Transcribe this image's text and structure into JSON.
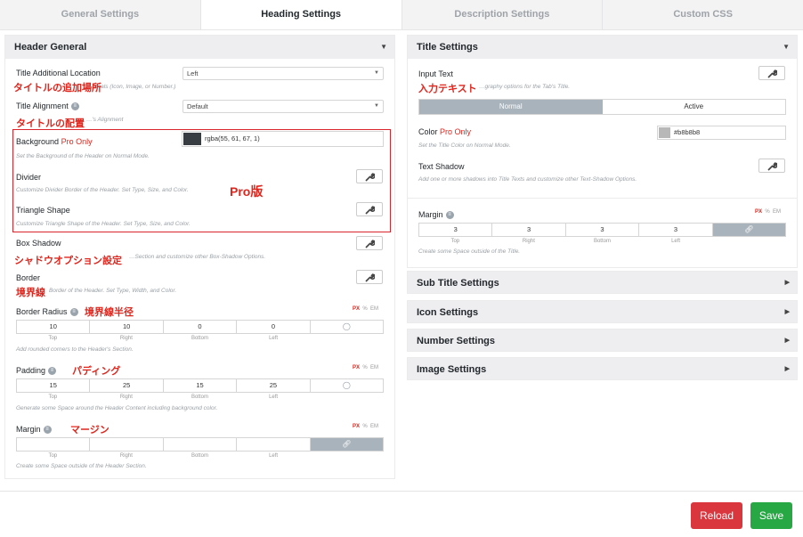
{
  "tabs": [
    "General Settings",
    "Heading Settings",
    "Description Settings",
    "Custom CSS"
  ],
  "left": {
    "title": "Header General",
    "title_location": {
      "label": "Title Additional Location",
      "value": "Left",
      "hint": "…ionals (Icon, Image, or Number.)",
      "jp": "タイトルの追加場所"
    },
    "title_alignment": {
      "label": "Title Alignment",
      "value": "Default",
      "hint": "…'s Alignment",
      "jp": "タイトルの配置"
    },
    "background": {
      "label": "Background",
      "pro": "Pro Only",
      "value": "rgba(55, 61, 67, 1)",
      "swatch": "#373d43",
      "hint": "Set the Background of the Header on Normal Mode."
    },
    "divider": {
      "label": "Divider",
      "hint": "Customize Divider Border of the Header. Set Type, Size, and Color."
    },
    "triangle": {
      "label": "Triangle Shape",
      "hint": "Customize Triangle Shape of the Header. Set Type, Size, and Color."
    },
    "pro_note": "Pro版",
    "box_shadow": {
      "label": "Box Shadow",
      "hint": "…Section and customize other Box-Shadow Options.",
      "jp": "シャドウオプション設定"
    },
    "border": {
      "label": "Border",
      "hint": "Border of the Header. Set Type, Width, and Color.",
      "jp": "境界線"
    },
    "border_radius": {
      "label": "Border Radius",
      "jp": "境界線半径",
      "values": [
        "10",
        "10",
        "0",
        "0"
      ],
      "labels": [
        "Top",
        "Right",
        "Bottom",
        "Left"
      ],
      "hint": "Add rounded corners to the Header's Section."
    },
    "padding": {
      "label": "Padding",
      "jp": "パディング",
      "values": [
        "15",
        "25",
        "15",
        "25"
      ],
      "labels": [
        "Top",
        "Right",
        "Bottom",
        "Left"
      ],
      "hint": "Generate some Space around the Header Content including background color."
    },
    "margin": {
      "label": "Margin",
      "jp": "マージン",
      "values": [
        "",
        "",
        "",
        ""
      ],
      "labels": [
        "Top",
        "Right",
        "Bottom",
        "Left"
      ],
      "hint": "Create some Space outside of the Header Section."
    },
    "units": {
      "px": "PX",
      "pct": "%",
      "em": "EM"
    }
  },
  "right": {
    "title": "Title Settings",
    "input_text": {
      "label": "Input Text",
      "hint": "…graphy options for the Tab's Title.",
      "jp": "入力テキスト"
    },
    "mode_tabs": [
      "Normal",
      "Active"
    ],
    "color": {
      "label": "Color",
      "pro": "Pro Only",
      "value": "#b8b8b8",
      "swatch": "#b8b8b8",
      "hint": "Set the Title Color on Normal Mode."
    },
    "text_shadow": {
      "label": "Text Shadow",
      "hint": "Add one or more shadows into Title Texts and customize other Text-Shadow Options."
    },
    "margin": {
      "label": "Margin",
      "values": [
        "3",
        "3",
        "3",
        "3"
      ],
      "labels": [
        "Top",
        "Right",
        "Bottom",
        "Left"
      ],
      "hint": "Create some Space outside of the Title."
    },
    "sections": [
      "Sub Title Settings",
      "Icon Settings",
      "Number Settings",
      "Image Settings"
    ]
  },
  "footer": {
    "reload": "Reload",
    "save": "Save"
  }
}
